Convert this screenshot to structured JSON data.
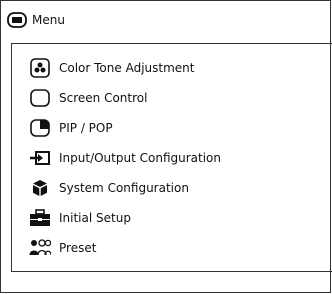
{
  "header": {
    "title": "Menu",
    "icon": "monitor-icon"
  },
  "menu": {
    "items": [
      {
        "label": "Color Tone Adjustment",
        "icon": "palette-icon"
      },
      {
        "label": "Screen Control",
        "icon": "screen-icon"
      },
      {
        "label": "PIP / POP",
        "icon": "pip-icon"
      },
      {
        "label": "Input/Output Configuration",
        "icon": "input-output-icon"
      },
      {
        "label": "System Configuration",
        "icon": "cube-icon"
      },
      {
        "label": "Initial Setup",
        "icon": "toolbox-icon"
      },
      {
        "label": "Preset",
        "icon": "users-icon"
      }
    ]
  },
  "colors": {
    "border": "#333333",
    "text": "#111111",
    "icon": "#111111"
  }
}
